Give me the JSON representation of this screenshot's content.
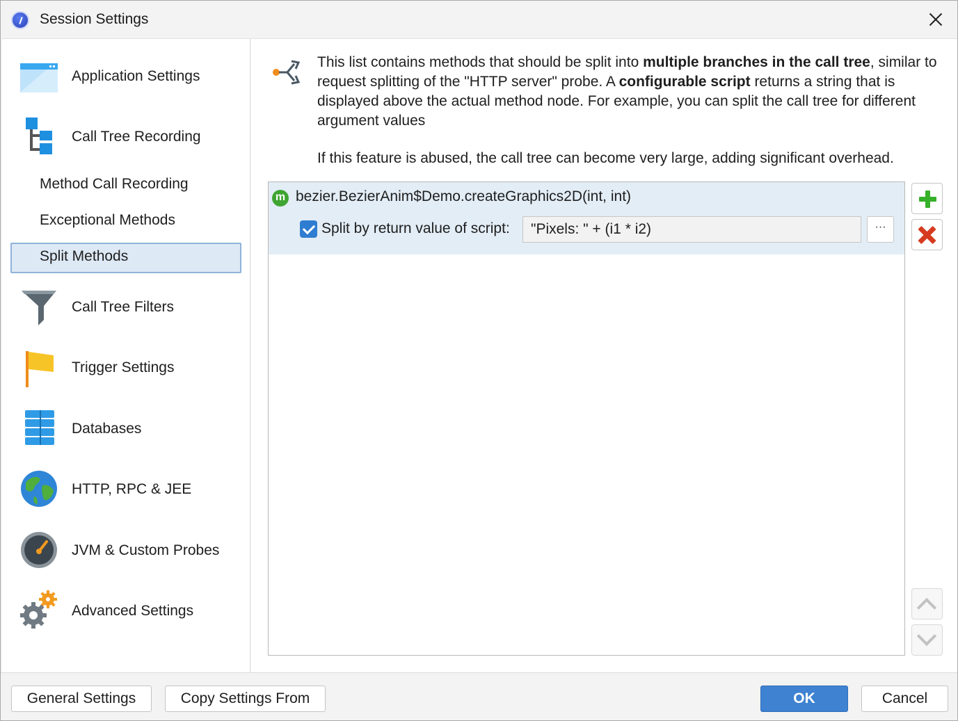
{
  "window": {
    "title": "Session Settings",
    "app_icon": "jprofiler-app-icon",
    "close_icon": "close-icon"
  },
  "sidebar": {
    "items": [
      {
        "label": "Application Settings",
        "icon": "application-window-icon"
      },
      {
        "label": "Call Tree Recording",
        "icon": "call-tree-icon"
      },
      {
        "label": "Method Call Recording",
        "sub": true
      },
      {
        "label": "Exceptional Methods",
        "sub": true
      },
      {
        "label": "Split Methods",
        "sub": true,
        "selected": true
      },
      {
        "label": "Call Tree Filters",
        "icon": "funnel-icon"
      },
      {
        "label": "Trigger Settings",
        "icon": "flag-icon"
      },
      {
        "label": "Databases",
        "icon": "database-icon"
      },
      {
        "label": "HTTP, RPC & JEE",
        "icon": "globe-icon"
      },
      {
        "label": "JVM & Custom Probes",
        "icon": "gauge-icon"
      },
      {
        "label": "Advanced Settings",
        "icon": "gears-icon"
      }
    ]
  },
  "main": {
    "header_icon": "split-branch-icon",
    "description": {
      "part1": "This list contains methods that should be split into ",
      "bold1": "multiple branches in the call tree",
      "part2": ", similar to request splitting of the \"HTTP server\" probe. A ",
      "bold2": "configurable script",
      "part3": " returns a string that is displayed above the actual method node. For example, you can split the call tree for different argument values"
    },
    "note": "If this feature is abused, the call tree can become very large, adding significant overhead.",
    "methods": [
      {
        "badge": "m",
        "name": "bezier.BezierAnim$Demo.createGraphics2D(int, int)",
        "split_checked": true,
        "split_label": "Split by return value of script:",
        "script": "\"Pixels: \" + (i1 * i2)",
        "browse_label": "···"
      }
    ],
    "side_buttons": {
      "add": "plus-icon",
      "remove": "remove-icon",
      "up": "chevron-up-icon",
      "down": "chevron-down-icon"
    }
  },
  "footer": {
    "general_settings": "General Settings",
    "copy_settings_from": "Copy Settings From",
    "ok": "OK",
    "cancel": "Cancel"
  },
  "colors": {
    "selection_bg": "#dde9f5",
    "selection_border": "#8fb3d9",
    "row_highlight": "#e3edf6",
    "primary_button": "#3f82d2",
    "add_green": "#37b02a",
    "remove_red": "#d63b1f"
  }
}
